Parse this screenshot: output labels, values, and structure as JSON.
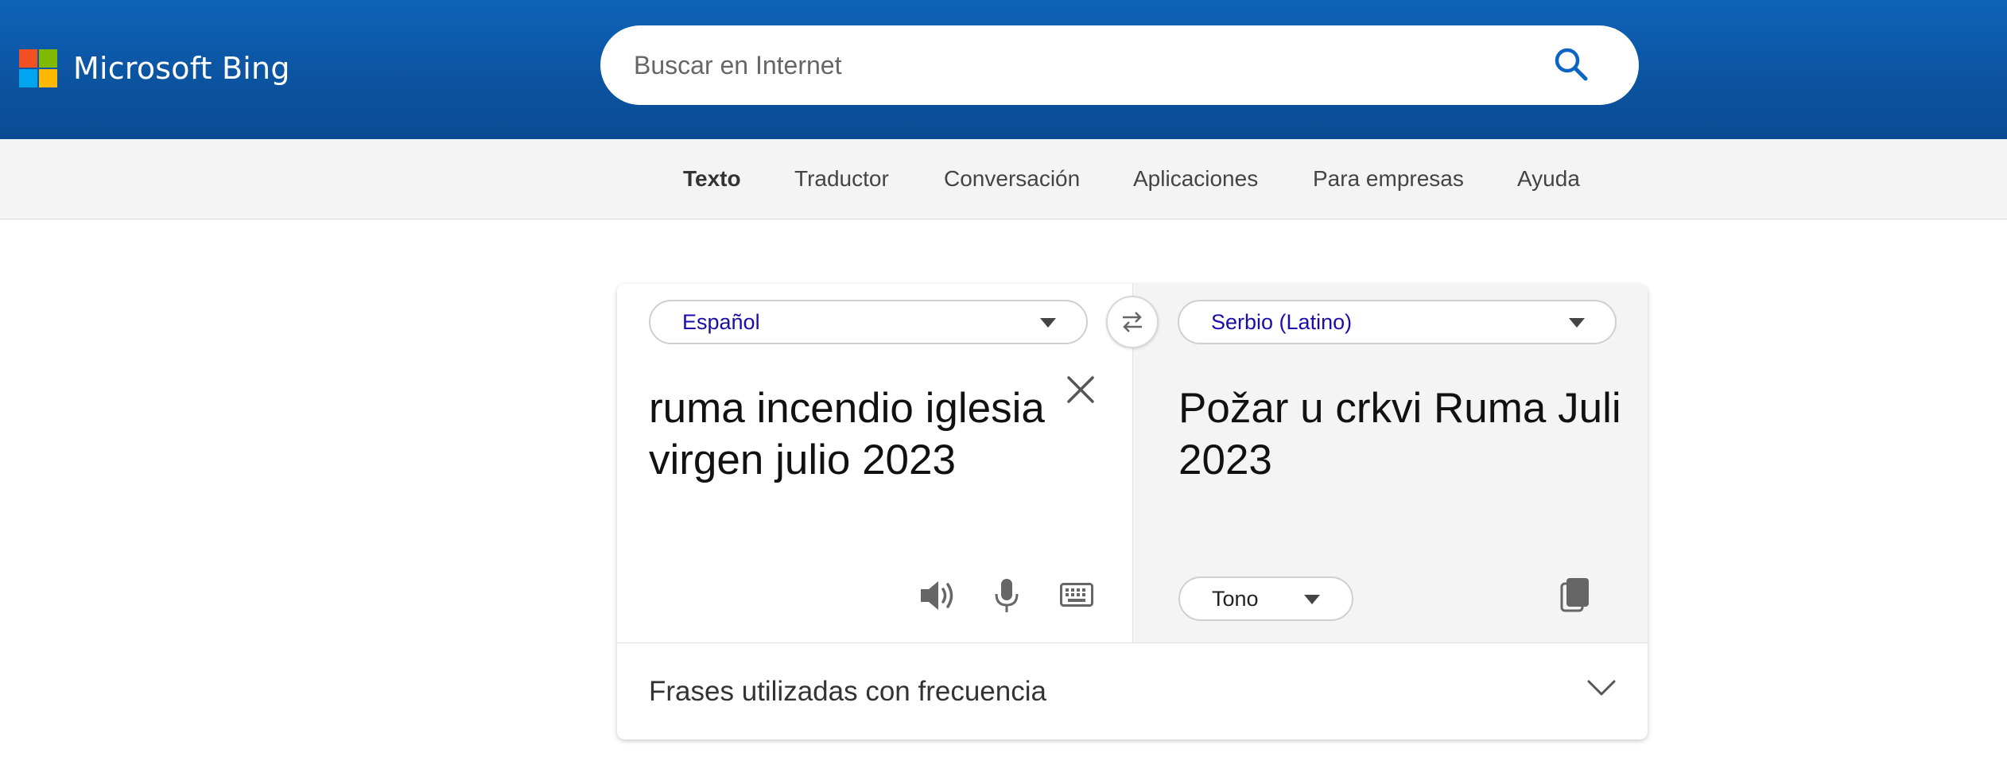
{
  "header": {
    "brand": "Microsoft Bing",
    "logo_colors": [
      "#f25022",
      "#7fba00",
      "#00a4ef",
      "#ffb900"
    ],
    "search_placeholder": "Buscar en Internet",
    "search_icon": "search-icon",
    "background_color": "#0b539f"
  },
  "nav": {
    "items": [
      {
        "label": "Texto",
        "active": true
      },
      {
        "label": "Traductor",
        "active": false
      },
      {
        "label": "Conversación",
        "active": false
      },
      {
        "label": "Aplicaciones",
        "active": false
      },
      {
        "label": "Para empresas",
        "active": false
      },
      {
        "label": "Ayuda",
        "active": false
      }
    ]
  },
  "translator": {
    "source_language": "Español",
    "target_language": "Serbio (Latino)",
    "source_text": "ruma incendio iglesia virgen julio 2023",
    "target_text": "Požar u crkvi Ruma Juli 2023",
    "tone_label": "Tono",
    "source_icons": [
      "speaker-icon",
      "microphone-icon",
      "keyboard-icon"
    ],
    "target_icons": [
      "copy-icon"
    ],
    "swap_icon": "swap-icon",
    "clear_icon": "close-icon",
    "link_color": "#1a0dab"
  },
  "frequent_phrases": {
    "label": "Frases utilizadas con frecuencia",
    "icon": "chevron-down-icon"
  }
}
